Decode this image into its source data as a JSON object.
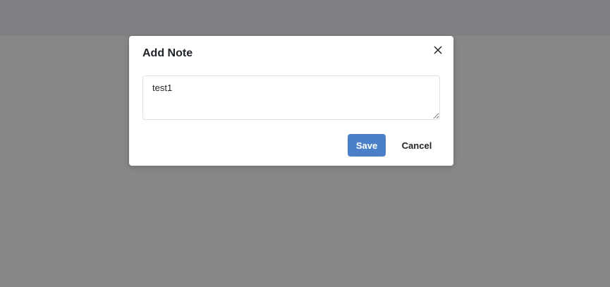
{
  "modal": {
    "title": "Add Note",
    "close_icon": "close-x-icon",
    "note_value": "test1",
    "save_label": "Save",
    "cancel_label": "Cancel"
  },
  "colors": {
    "primary": "#4a80c8",
    "backdrop": "#878787"
  }
}
